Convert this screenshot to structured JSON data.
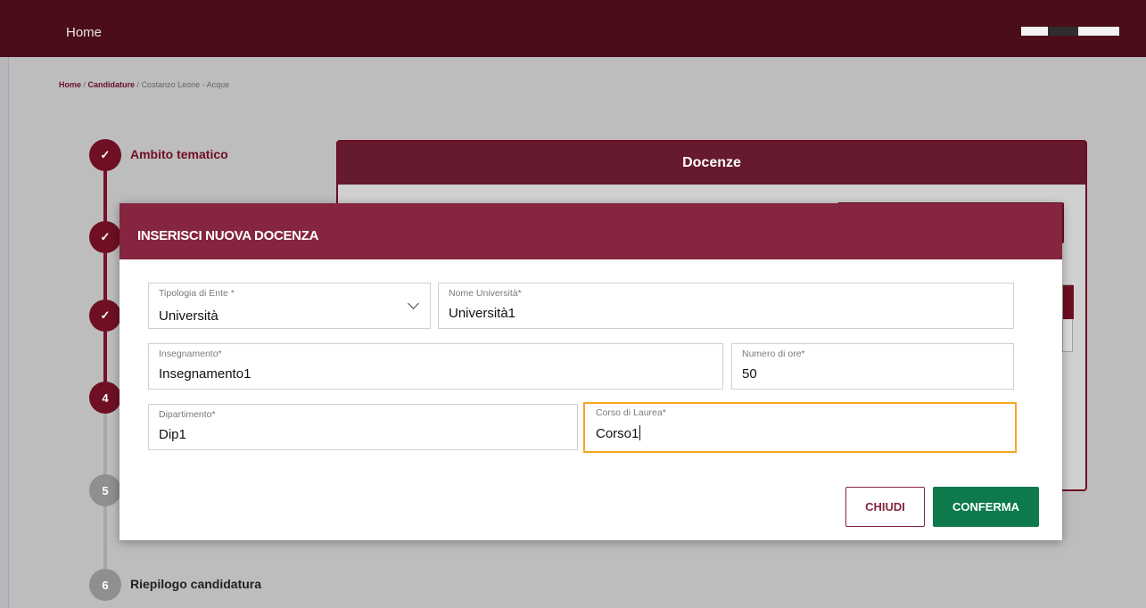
{
  "header": {
    "home_label": "Home"
  },
  "breadcrumb": {
    "home": "Home",
    "separator": " / ",
    "candidature": "Candidature",
    "current": "Costanzo Leone - Acque"
  },
  "stepper": {
    "steps": [
      {
        "marker": "✓",
        "label": "Ambito tematico"
      },
      {
        "marker": "✓",
        "label": ""
      },
      {
        "marker": "✓",
        "label": ""
      },
      {
        "marker": "4",
        "label": ""
      },
      {
        "marker": "5",
        "label": ""
      },
      {
        "marker": "6",
        "label": "Riepilogo candidatura"
      }
    ]
  },
  "docenze_card": {
    "title": "Docenze"
  },
  "modal": {
    "title": "INSERISCI NUOVA DOCENZA",
    "fields": {
      "tipologia_ente": {
        "label": "Tipologia di Ente *",
        "value": "Università"
      },
      "nome_universita": {
        "label": "Nome Università*",
        "value": "Università1"
      },
      "insegnamento": {
        "label": "Insegnamento*",
        "value": "Insegnamento1"
      },
      "numero_ore": {
        "label": "Numero di ore*",
        "value": "50"
      },
      "dipartimento": {
        "label": "Dipartimento*",
        "value": "Dip1"
      },
      "corso_laurea": {
        "label": "Corso di Laurea*",
        "value": "Corso1"
      }
    },
    "buttons": {
      "close": "CHIUDI",
      "confirm": "CONFERMA"
    }
  },
  "colors": {
    "topbar": "#4a0d19",
    "brand": "#852540",
    "step_done": "#6e0f23",
    "confirm": "#0e7a4c",
    "focus": "#f5a623"
  }
}
